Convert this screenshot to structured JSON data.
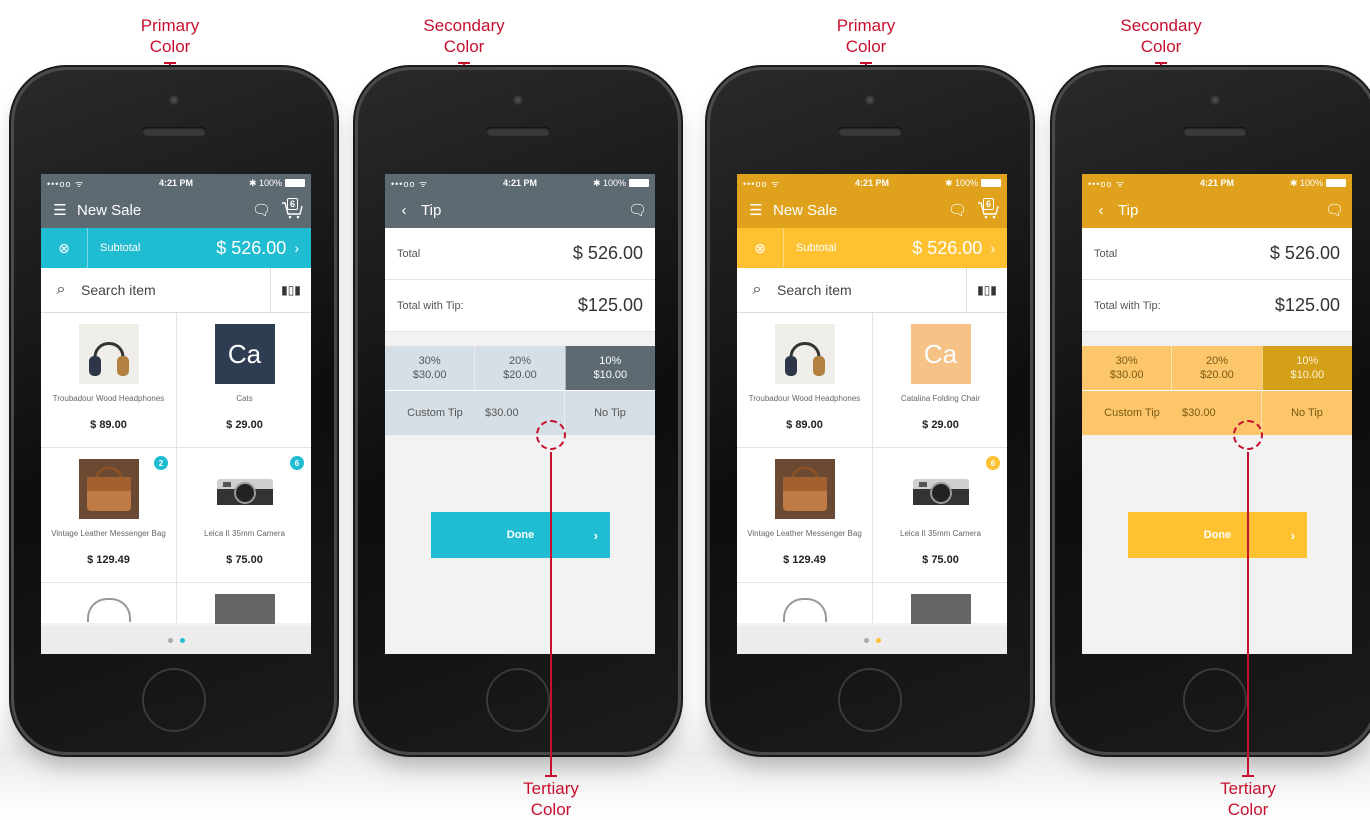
{
  "annotations": {
    "primary": [
      "Primary",
      "Color"
    ],
    "secondary": [
      "Secondary",
      "Color"
    ],
    "tertiary": [
      "Tertiary",
      "Color"
    ]
  },
  "themes": {
    "teal": {
      "nav": "#5e6a72",
      "accent": "#1fbcd2",
      "tip_bg": "#d7dfe6",
      "tip_sel": "#5e6a72",
      "tip_text": "#555555",
      "tip_sel_text": "#ffffff",
      "done": "#1fbcd2",
      "badge": "#1fbcd2",
      "status": "#5e6a72"
    },
    "yellow": {
      "nav": "#e0a21c",
      "accent": "#fec131",
      "tip_bg": "#fdc66a",
      "tip_sel": "#d4a017",
      "tip_text": "#7a5a10",
      "tip_sel_text": "#fff3d6",
      "done": "#fec131",
      "badge": "#fec131",
      "status": "#e0a21c"
    }
  },
  "status_bar": {
    "signal": "•••oo ᯤ",
    "time": "4:21 PM",
    "battery": "✱ 100%"
  },
  "sale_screen": {
    "title": "New Sale",
    "cart_count": "6",
    "subtotal_label": "Subtotal",
    "subtotal_value": "$ 526.00",
    "search_placeholder": "Search item",
    "products_teal": [
      {
        "name": "Troubadour Wood Headphones",
        "price": "$ 89.00",
        "badge": ""
      },
      {
        "name": "Cats",
        "price": "$ 29.00",
        "badge": ""
      },
      {
        "name": "Vintage Leather Messenger Bag",
        "price": "$ 129.49",
        "badge": "2"
      },
      {
        "name": "Leica II 35mm Camera",
        "price": "$ 75.00",
        "badge": "6"
      }
    ],
    "products_yellow": [
      {
        "name": "Troubadour Wood Headphones",
        "price": "$ 89.00",
        "badge": ""
      },
      {
        "name": "Catalina Folding Chair",
        "price": "$ 29.00",
        "badge": ""
      },
      {
        "name": "Vintage Leather Messenger Bag",
        "price": "$ 129.49",
        "badge": ""
      },
      {
        "name": "Leica II 35mm Camera",
        "price": "$ 75.00",
        "badge": "6"
      }
    ],
    "tile_text": "Ca"
  },
  "tip_screen": {
    "title": "Tip",
    "total_label": "Total",
    "total_value": "$ 526.00",
    "total_tip_label": "Total with Tip:",
    "total_tip_value": "$125.00",
    "options": [
      {
        "pct": "30%",
        "amt": "$30.00"
      },
      {
        "pct": "20%",
        "amt": "$20.00"
      },
      {
        "pct": "10%",
        "amt": "$10.00"
      }
    ],
    "custom_label": "Custom Tip",
    "custom_value": "$30.00",
    "no_tip": "No Tip",
    "done": "Done"
  }
}
